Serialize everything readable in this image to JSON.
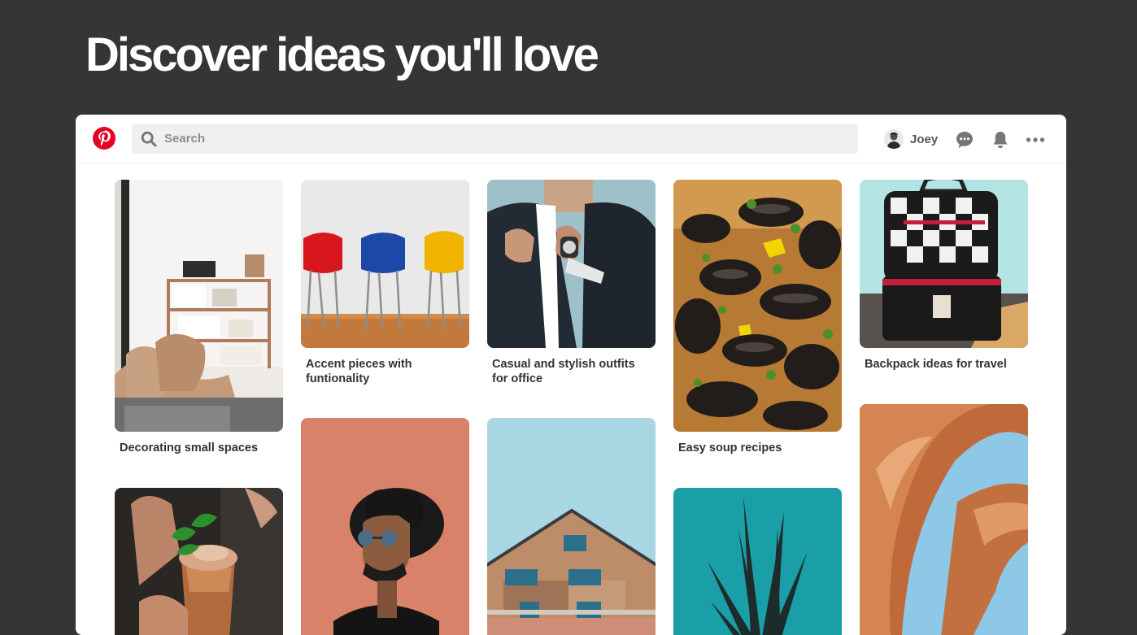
{
  "hero": {
    "title": "Discover ideas you'll love"
  },
  "header": {
    "logo_icon": "pinterest-logo",
    "search": {
      "placeholder": "Search",
      "value": "",
      "icon": "search-icon"
    },
    "profile": {
      "name": "Joey",
      "avatar_icon": "avatar"
    },
    "icons": [
      "message-icon",
      "bell-icon",
      "more-icon"
    ]
  },
  "colors": {
    "brand": "#e60023",
    "background": "#353535",
    "search_bg": "#efefef"
  },
  "pins": [
    {
      "title": "Decorating small spaces"
    },
    {
      "title": "Accent pieces with funtionality"
    },
    {
      "title": "Casual and stylish outfits for office"
    },
    {
      "title": "Easy soup recipes"
    },
    {
      "title": "Backpack ideas for travel"
    },
    {
      "title": ""
    },
    {
      "title": ""
    },
    {
      "title": ""
    },
    {
      "title": ""
    },
    {
      "title": ""
    }
  ]
}
